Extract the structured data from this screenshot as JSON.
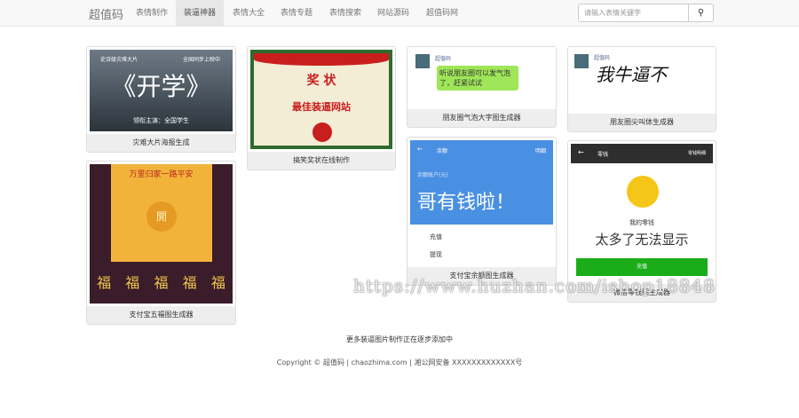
{
  "nav": {
    "brand": "超值码",
    "items": [
      "表情制作",
      "装逼神器",
      "表情大全",
      "表情专题",
      "表情搜索",
      "网站源码",
      "超值码网"
    ],
    "active": 1,
    "search_placeholder": "请输入表情关键字",
    "search_icon": "search-icon"
  },
  "cards": [
    {
      "caption": "灾难大片海报生成",
      "thumb": {
        "top_left": "史诗级灾难大片",
        "top_right": "全国同步上映中",
        "title": "《开学》",
        "sub": "领衔主演：全国学生"
      }
    },
    {
      "caption": "搞笑奖状在线制作",
      "thumb": {
        "title": "奖 状",
        "body": "最佳装逼网站"
      }
    },
    {
      "caption": "朋友圈气泡大字图生成器",
      "thumb": {
        "name": "超值码",
        "bubble": "听说朋友圈可以发气泡了，赶紧试试"
      }
    },
    {
      "caption": "朋友圈尖叫体生成器",
      "thumb": {
        "name": "超值码",
        "text": "我牛逼不"
      }
    },
    {
      "caption": "支付宝五福图生成器",
      "thumb": {
        "title": "万里归家一路平安",
        "seal": "開",
        "fu": "福"
      }
    },
    {
      "caption": "支付宝余额图生成器",
      "thumb": {
        "header": "余额",
        "detail": "明细",
        "label": "余额账户(元)",
        "amount": "哥有钱啦！",
        "row1": "充值",
        "row2": "提现"
      }
    },
    {
      "caption": "微信零钱图生成器",
      "thumb": {
        "header": "零钱",
        "detail": "零钱明细",
        "label": "我的零钱",
        "amount": "太多了无法显示",
        "button": "充值"
      }
    }
  ],
  "footer": {
    "note": "更多装逼图片制作正在逐步添加中",
    "copyright": "Copyright © 超值码 | chaozhima.com | 湘公网安备 XXXXXXXXXXXXX号"
  },
  "watermark": "https://www.huzhan.com/ishop18848"
}
